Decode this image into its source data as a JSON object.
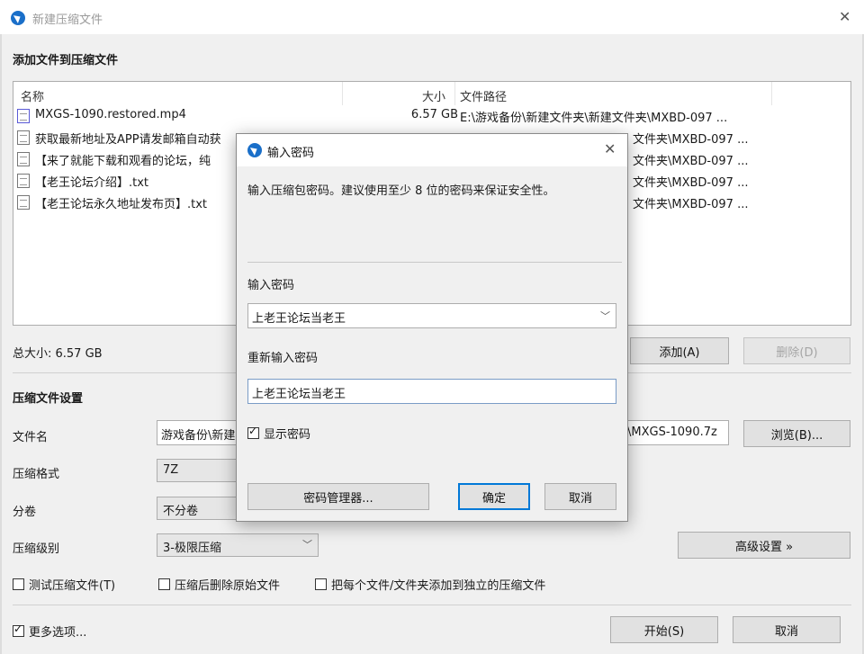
{
  "window": {
    "title": "新建压缩文件",
    "close_glyph": "✕"
  },
  "add_section": {
    "title": "添加文件到压缩文件",
    "columns": {
      "name": "名称",
      "size": "大小",
      "path": "文件路径"
    },
    "files": [
      {
        "name": "MXGS-1090.restored.mp4",
        "size": "6.57 GB",
        "path": "E:\\游戏备份\\新建文件夹\\新建文件夹\\MXBD-097 ...",
        "icon": "video-file-icon"
      },
      {
        "name": "获取最新地址及APP请发邮箱自动获",
        "size": "",
        "path": "文件夹\\MXBD-097 ...",
        "icon": "text-file-icon"
      },
      {
        "name": "【来了就能下载和观看的论坛，纯",
        "size": "",
        "path": "文件夹\\MXBD-097 ...",
        "icon": "text-file-icon"
      },
      {
        "name": "【老王论坛介绍】.txt",
        "size": "",
        "path": "文件夹\\MXBD-097 ...",
        "icon": "text-file-icon"
      },
      {
        "name": "【老王论坛永久地址发布页】.txt",
        "size": "",
        "path": "文件夹\\MXBD-097 ...",
        "icon": "text-file-icon"
      }
    ],
    "total_size": "总大小: 6.57 GB",
    "add_button": "添加(A)",
    "delete_button": "删除(D)"
  },
  "settings": {
    "title": "压缩文件设置",
    "filename_label": "文件名",
    "filename_value": "游戏备份\\新建",
    "filename_tail": "\\MXGS-1090.7z",
    "browse_button": "浏览(B)...",
    "format_label": "压缩格式",
    "format_value": "7Z",
    "split_label": "分卷",
    "split_value": "不分卷",
    "level_label": "压缩级别",
    "level_value": "3-极限压缩",
    "advanced_button": "高级设置 »",
    "test_checkbox": "测试压缩文件(T)",
    "delete_checkbox": "压缩后删除原始文件",
    "separate_checkbox": "把每个文件/文件夹添加到独立的压缩文件",
    "more_options": "更多选项...",
    "start_button": "开始(S)",
    "cancel_button": "取消"
  },
  "modal": {
    "title": "输入密码",
    "message": "输入压缩包密码。建议使用至少 8 位的密码来保证安全性。",
    "password_label": "输入密码",
    "password_value": "上老王论坛当老王",
    "reenter_label": "重新输入密码",
    "reenter_value": "上老王论坛当老王",
    "show_password": "显示密码",
    "manager_button": "密码管理器...",
    "ok_button": "确定",
    "cancel_button": "取消"
  },
  "colors": {
    "accent": "#0078d7",
    "app_icon": "#1a6fc9"
  }
}
